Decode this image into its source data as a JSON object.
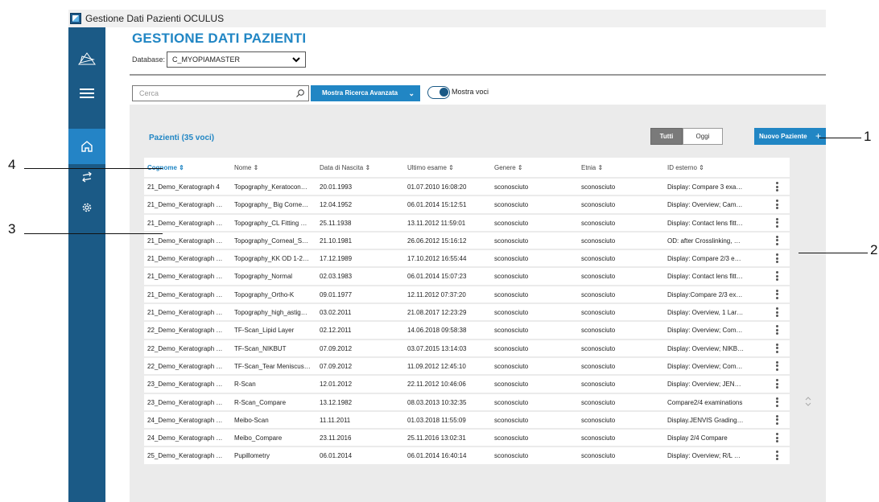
{
  "window": {
    "title": "Gestione Dati Pazienti OCULUS"
  },
  "header": {
    "title": "GESTIONE DATI PAZIENTI",
    "db_label": "Database:",
    "db_value": "C_MYOPIAMASTER"
  },
  "toolbar": {
    "search_placeholder": "Cerca",
    "advanced_label": "Mostra Ricerca Avanzata",
    "toggle_label": "Mostra voci",
    "toggle_on": true
  },
  "panel": {
    "count_title": "Pazienti (35 voci)",
    "filter_all": "Tutti",
    "filter_today": "Oggi",
    "new_patient": "Nuovo Paziente"
  },
  "table": {
    "columns": [
      "Cognome",
      "Nome",
      "Data di Nascita",
      "Ultimo esame",
      "Genere",
      "Etnia",
      "ID esterno"
    ],
    "sort_column": "Cognome",
    "rows": [
      [
        "21_Demo_Keratograph 4",
        "Topography_Keratocon…",
        "20.01.1993",
        "01.07.2010 16:08:20",
        "sconosciuto",
        "sconosciuto",
        "Display: Compare 3 exa…"
      ],
      [
        "21_Demo_Keratograph …",
        "Topography_ Big Corne…",
        "12.04.1952",
        "06.01.2014 15:12:51",
        "sconosciuto",
        "sconosciuto",
        "Display: Overview; Cam…"
      ],
      [
        "21_Demo_Keratograph …",
        "Topography_CL Fitting …",
        "25.11.1938",
        "13.11.2012 11:59:01",
        "sconosciuto",
        "sconosciuto",
        "Display: Contact lens fitt…"
      ],
      [
        "21_Demo_Keratograph …",
        "Topography_Corneal_S…",
        "21.10.1981",
        "26.06.2012 15:16:12",
        "sconosciuto",
        "sconosciuto",
        "OD: after Crosslinking, …"
      ],
      [
        "21_Demo_Keratograph …",
        "Topography_KK OD 1-2…",
        "17.12.1989",
        "17.10.2012 16:55:44",
        "sconosciuto",
        "sconosciuto",
        "Display: Compare 2/3 e…"
      ],
      [
        "21_Demo_Keratograph …",
        "Topography_Normal",
        "02.03.1983",
        "06.01.2014 15:07:23",
        "sconosciuto",
        "sconosciuto",
        "Display: Contact lens fitt…"
      ],
      [
        "21_Demo_Keratograph …",
        "Topography_Ortho-K",
        "09.01.1977",
        "12.11.2012 07:37:20",
        "sconosciuto",
        "sconosciuto",
        "Display:Compare 2/3 ex…"
      ],
      [
        "21_Demo_Keratograph …",
        "Topography_high_astig…",
        "03.02.2011",
        "21.08.2017 12:23:29",
        "sconosciuto",
        "sconosciuto",
        "Display: Overview, 1 Lar…"
      ],
      [
        "22_Demo_Keratograph …",
        "TF-Scan_Lipid Layer",
        "02.12.2011",
        "14.06.2018 09:58:38",
        "sconosciuto",
        "sconosciuto",
        "Display: Overview; Com…"
      ],
      [
        "22_Demo_Keratograph …",
        "TF-Scan_NIKBUT",
        "07.09.2012",
        "03.07.2015 13:14:03",
        "sconosciuto",
        "sconosciuto",
        "Display: Overview; NIKB…"
      ],
      [
        "22_Demo_Keratograph …",
        "TF-Scan_Tear Meniscus…",
        "07.09.2012",
        "11.09.2012 12:45:10",
        "sconosciuto",
        "sconosciuto",
        "Display: Overview; Com…"
      ],
      [
        "23_Demo_Keratograph …",
        "R-Scan",
        "12.01.2012",
        "22.11.2012 10:46:06",
        "sconosciuto",
        "sconosciuto",
        "Display: Overview; JEN…"
      ],
      [
        "23_Demo_Keratograph …",
        "R-Scan_Compare",
        "13.12.1982",
        "08.03.2013 10:32:35",
        "sconosciuto",
        "sconosciuto",
        "Compare2/4 examinations"
      ],
      [
        "24_Demo_Keratograph …",
        "Meibo-Scan",
        "11.11.2011",
        "01.03.2018 11:55:09",
        "sconosciuto",
        "sconosciuto",
        "Display.JENVIS Grading…"
      ],
      [
        "24_Demo_Keratograph …",
        "Meibo_Compare",
        "23.11.2016",
        "25.11.2016 13:02:31",
        "sconosciuto",
        "sconosciuto",
        "Display 2/4 Compare"
      ],
      [
        "25_Demo_Keratograph …",
        "Pupillometry",
        "06.01.2014",
        "06.01.2014 16:40:14",
        "sconosciuto",
        "sconosciuto",
        "Display: Overview; R/L …"
      ]
    ]
  },
  "callouts": [
    "1",
    "2",
    "3",
    "4"
  ],
  "colors": {
    "accent": "#2186c4",
    "sidebar": "#1b5a86",
    "panel": "#ebebeb"
  }
}
